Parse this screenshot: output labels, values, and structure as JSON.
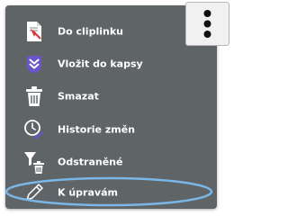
{
  "menu": {
    "items": [
      {
        "label": "Do cliplinku",
        "icon": "clipboard-add-icon"
      },
      {
        "label": "Vložit do kapsy",
        "icon": "pocket-icon"
      },
      {
        "label": "Smazat",
        "icon": "trash-icon"
      },
      {
        "label": "Historie změn",
        "icon": "history-icon"
      },
      {
        "label": "Odstraněné",
        "icon": "filter-trash-icon"
      },
      {
        "label": "K úpravám",
        "icon": "pencil-icon"
      }
    ]
  },
  "more_button": {
    "icon": "kebab-menu-icon"
  },
  "colors": {
    "menu_bg": "#5f6466",
    "text": "#ffffff",
    "accent_purple": "#6a55c9",
    "highlight_ring": "#7ab6e6",
    "alert_red": "#d23b3b"
  }
}
